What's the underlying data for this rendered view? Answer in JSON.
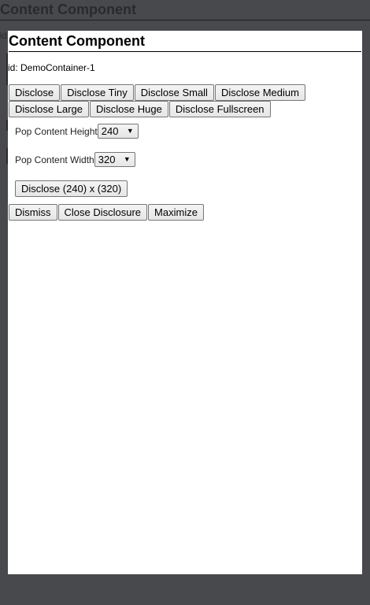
{
  "background": {
    "title": "Content Component",
    "id_fragment": "id"
  },
  "modal": {
    "title": "Content Component",
    "id_text": "id: DemoContainer-1",
    "row1": [
      "Disclose",
      "Disclose Tiny",
      "Disclose Small",
      "Disclose Medium"
    ],
    "row2": [
      "Disclose Large",
      "Disclose Huge",
      "Disclose Fullscreen"
    ],
    "height_field": {
      "label": "Pop Content Height",
      "value": "240"
    },
    "width_field": {
      "label": "Pop Content Width",
      "value": "320"
    },
    "custom_disclose_label": "Disclose (240) x (320)",
    "row3": [
      "Dismiss",
      "Close Disclosure",
      "Maximize"
    ]
  },
  "colors": {
    "backdrop": "#48494d",
    "panel": "#ffffff"
  }
}
